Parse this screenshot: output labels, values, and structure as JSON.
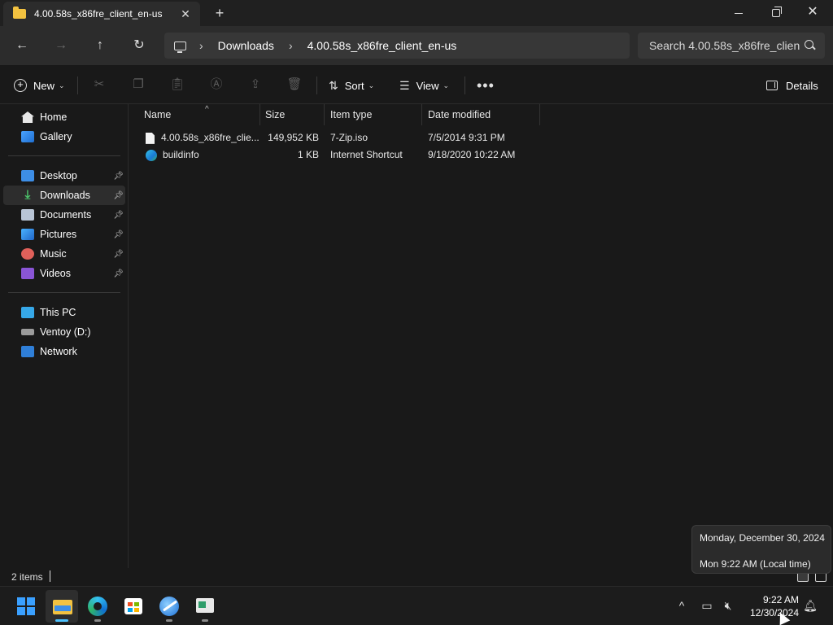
{
  "window": {
    "tab_title": "4.00.58s_x86fre_client_en-us",
    "tab_close": "✕",
    "new_tab": "+"
  },
  "address": {
    "breadcrumbs": [
      "Downloads",
      "4.00.58s_x86fre_client_en-us"
    ],
    "search_placeholder": "Search 4.00.58s_x86fre_client_en-us"
  },
  "toolbar": {
    "new_label": "New",
    "sort_label": "Sort",
    "view_label": "View",
    "more_label": "•••",
    "details_label": "Details"
  },
  "sidebar": {
    "quick": [
      {
        "label": "Home",
        "icon": "home-icon"
      },
      {
        "label": "Gallery",
        "icon": "gallery-icon"
      }
    ],
    "pinned": [
      {
        "label": "Desktop",
        "icon": "desktop-icon"
      },
      {
        "label": "Downloads",
        "icon": "downloads-icon",
        "selected": true
      },
      {
        "label": "Documents",
        "icon": "documents-icon"
      },
      {
        "label": "Pictures",
        "icon": "pictures-icon"
      },
      {
        "label": "Music",
        "icon": "music-icon"
      },
      {
        "label": "Videos",
        "icon": "videos-icon"
      }
    ],
    "devices": [
      {
        "label": "This PC",
        "icon": "this-pc-icon"
      },
      {
        "label": "Ventoy (D:)",
        "icon": "drive-icon"
      },
      {
        "label": "Network",
        "icon": "network-icon"
      }
    ]
  },
  "columns": {
    "name": "Name",
    "size": "Size",
    "type": "Item type",
    "date": "Date modified"
  },
  "files": [
    {
      "name": "4.00.58s_x86fre_clie...",
      "size": "149,952 KB",
      "type": "7-Zip.iso",
      "date": "7/5/2014 9:31 PM",
      "icon": "file-icon"
    },
    {
      "name": "buildinfo",
      "size": "1 KB",
      "type": "Internet Shortcut",
      "date": "9/18/2020 10:22 AM",
      "icon": "internet-shortcut-icon"
    }
  ],
  "status": {
    "item_count": "2 items"
  },
  "tooltip": {
    "date_long": "Monday, December 30, 2024",
    "time_local": "Mon 9:22 AM (Local time)"
  },
  "taskbar": {
    "time": "9:22 AM",
    "date": "12/30/2024",
    "tray_chevron": "^"
  },
  "colors": {
    "accent": "#4cc2ff",
    "folder": "#f3c240",
    "background": "#191919"
  }
}
